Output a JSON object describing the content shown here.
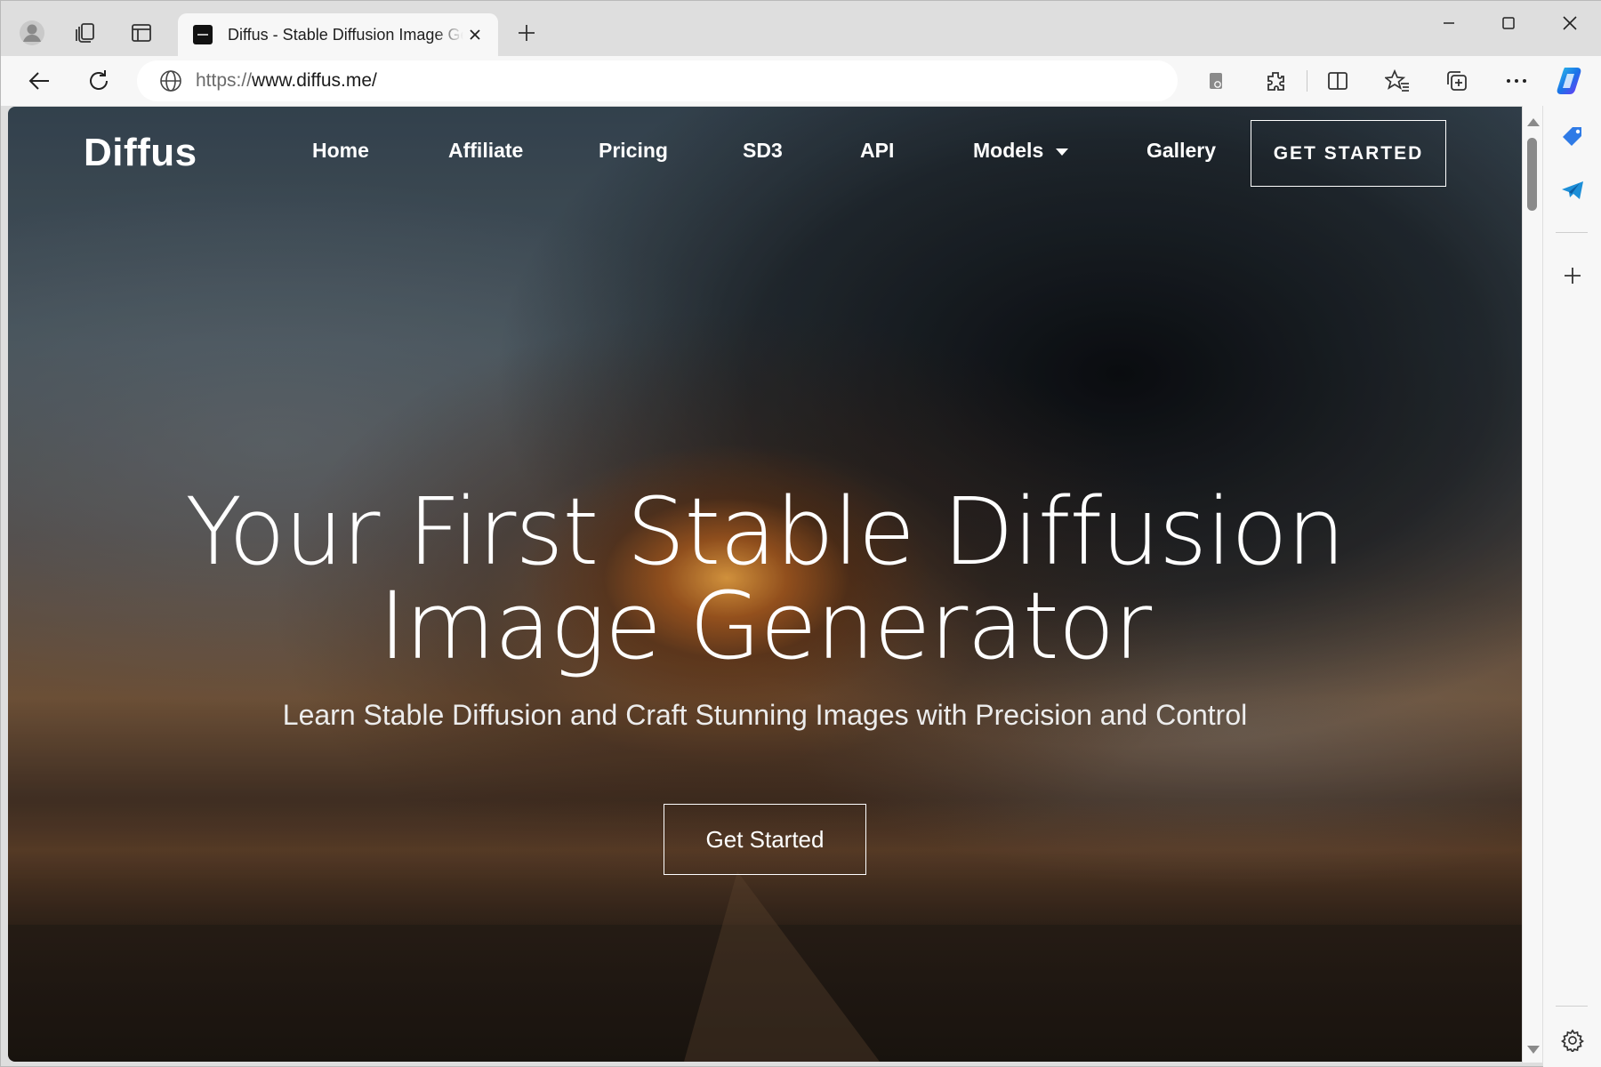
{
  "browser": {
    "tab": {
      "title": "Diffus - Stable Diffusion Image Generator"
    },
    "address_bar": {
      "scheme": "https://",
      "host": "www.diffus.me/"
    }
  },
  "site": {
    "logo": "Diffus",
    "nav": {
      "items": [
        "Home",
        "Affiliate",
        "Pricing",
        "SD3",
        "API",
        "Models",
        "Gallery"
      ],
      "cta": "GET STARTED"
    },
    "hero": {
      "title_line1": "Your First Stable Diffusion",
      "title_line2": "Image Generator",
      "subtitle": "Learn Stable Diffusion and Craft Stunning Images with Precision and Control",
      "button": "Get Started"
    }
  },
  "icons": {
    "titlebar": [
      "profile-icon",
      "workspaces-icon",
      "vertical-tabs-icon"
    ],
    "toolbar": [
      "back-icon",
      "refresh-icon",
      "globe-icon",
      "reader-icon",
      "extensions-icon",
      "split-screen-icon",
      "favorites-icon",
      "collections-icon",
      "more-icon",
      "copilot-icon"
    ],
    "sidebar": [
      "shopping-tag-icon",
      "telegram-icon",
      "add-icon",
      "settings-icon"
    ]
  },
  "colors": {
    "chrome_bg": "#dedede",
    "toolbar_bg": "#f7f7f7",
    "copilot_blue": "#1a73e8",
    "hero_text": "#ffffff"
  }
}
